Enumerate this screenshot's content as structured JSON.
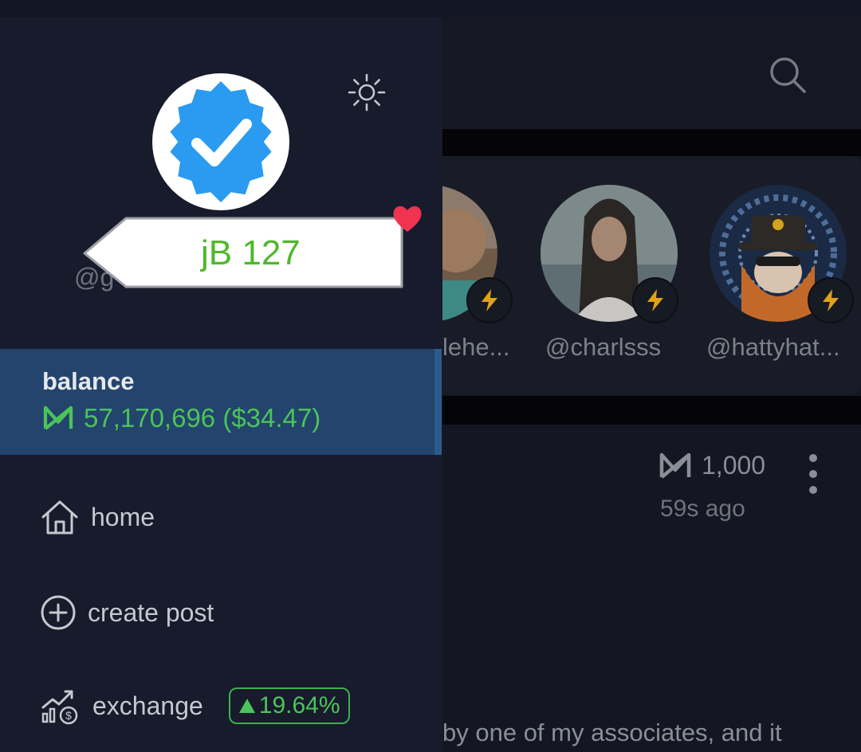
{
  "drawer": {
    "handle": "@g",
    "balance": {
      "title": "balance",
      "value": "57,170,696 ($34.47)",
      "icon": "coin-logo-icon"
    },
    "nav": {
      "home": "home",
      "create_post": "create post",
      "exchange": "exchange",
      "exchange_change": "19.64%"
    }
  },
  "overlay_tag": {
    "label": "jB 127"
  },
  "stories": [
    {
      "name": "lehe..."
    },
    {
      "name": "@charlsss"
    },
    {
      "name": "@hattyhat..."
    }
  ],
  "post": {
    "amount": "1,000",
    "time": "59s ago",
    "text": "by one of my associates, and it"
  },
  "colors": {
    "drawer_bg": "#171b2c",
    "balance_bg": "#23446d",
    "accent_green": "#4cc35a",
    "verified_blue": "#2a9bf0",
    "heart_red": "#f0334f",
    "lightning_gold": "#e0a21a"
  }
}
